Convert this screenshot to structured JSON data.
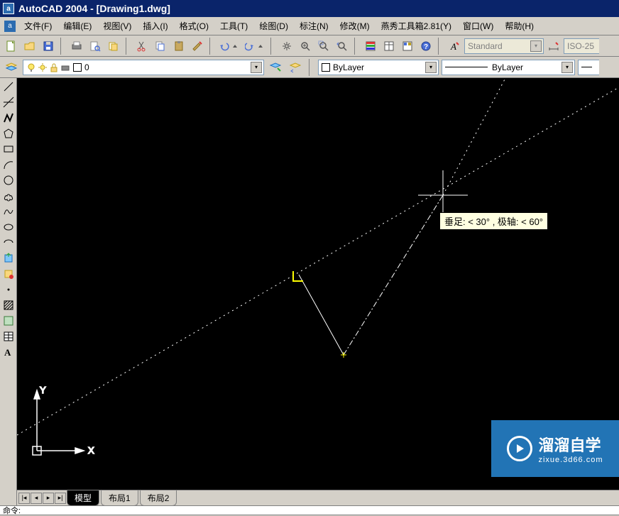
{
  "title": "AutoCAD 2004 - [Drawing1.dwg]",
  "menu": {
    "file": "文件(F)",
    "edit": "编辑(E)",
    "view": "视图(V)",
    "insert": "插入(I)",
    "format": "格式(O)",
    "tools": "工具(T)",
    "draw": "绘图(D)",
    "dimension": "标注(N)",
    "modify": "修改(M)",
    "yanxiu": "燕秀工具箱2.81(Y)",
    "window": "窗口(W)",
    "help": "帮助(H)"
  },
  "layer": {
    "current": "0",
    "color_control": "ByLayer",
    "linetype_control": "ByLayer"
  },
  "textstyle": "Standard",
  "dimstyle": "ISO-25",
  "tooltip": "垂足:  < 30° ,    极轴:  < 60°",
  "ucs": {
    "x": "X",
    "y": "Y"
  },
  "tabs": {
    "model": "模型",
    "layout1": "布局1",
    "layout2": "布局2"
  },
  "cmd_prompt": "命令:",
  "watermark": {
    "brand": "溜溜自学",
    "url": "zixue.3d66.com"
  },
  "icons": {
    "new": "new",
    "open": "open",
    "save": "save",
    "print": "print",
    "preview": "preview",
    "publish": "publish",
    "cut": "cut",
    "copy": "copy",
    "paste": "paste",
    "match": "match",
    "undo": "undo",
    "redo": "redo",
    "pan": "pan",
    "zoomrt": "zoomrt",
    "zoomwin": "zoomwin",
    "zoomprev": "zoomprev",
    "props": "props",
    "designcenter": "designcenter",
    "toolpalette": "toolpalette",
    "help": "help",
    "layer_mgr": "layer-manager",
    "layer_prev": "layer-previous",
    "line": "line",
    "cline": "construction-line",
    "pline": "polyline",
    "polygon": "polygon",
    "rect": "rectangle",
    "arc": "arc",
    "circle": "circle",
    "revcloud": "revcloud",
    "spline": "spline",
    "ellipse": "ellipse",
    "ellipsearc": "ellipse-arc",
    "insertblock": "insert-block",
    "makeblock": "make-block",
    "point": "point",
    "hatch": "hatch",
    "region": "region",
    "table": "table",
    "mtext": "mtext"
  }
}
